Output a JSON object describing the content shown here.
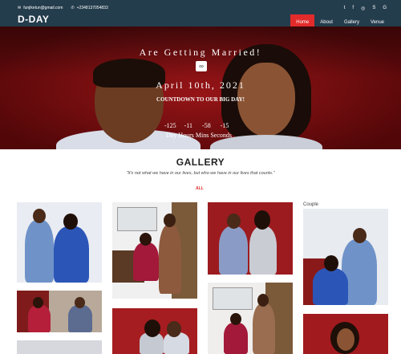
{
  "header": {
    "email": "funjiketun@gmail.com",
    "phone": "+2348137054833",
    "brand": "D-DAY",
    "social_icons": [
      "twitter-icon",
      "facebook-icon",
      "instagram-icon",
      "skype-icon",
      "google-plus-icon"
    ],
    "social_glyphs": [
      "t",
      "f",
      "◎",
      "S",
      "G"
    ],
    "nav": [
      {
        "label": "Home",
        "active": true
      },
      {
        "label": "About",
        "active": false
      },
      {
        "label": "Gallery",
        "active": false
      },
      {
        "label": "Venue",
        "active": false
      }
    ]
  },
  "hero": {
    "headline": "Are Getting Married!",
    "ring_icon": "rings-icon",
    "date": "April 10th, 2021",
    "countdown_title": "COUNTDOWN TO OUR BIG DAY!",
    "timer": {
      "days": "-125",
      "hours": "-11",
      "mins": "-58",
      "secs": "-15"
    },
    "timer_labels": "Day Hours Mins Seconds"
  },
  "gallery": {
    "title": "GALLERY",
    "quote": "\"It's not what we have in our lives, but who we have in our lives that counts.\"",
    "filter": "ALL",
    "couple_label": "Couple"
  },
  "colors": {
    "topbar": "#243d4d",
    "accent": "#e32b2b"
  }
}
